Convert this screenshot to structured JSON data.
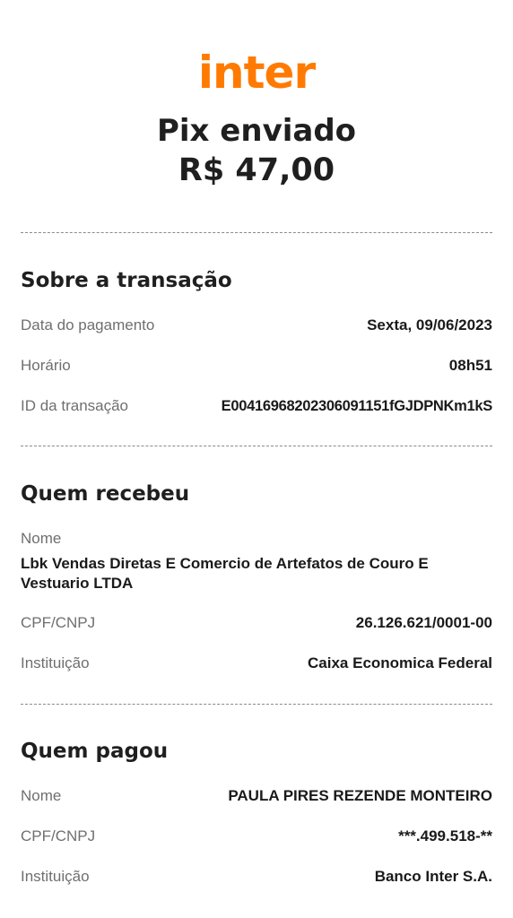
{
  "brand": {
    "logo_text": "inter",
    "accent_color": "#ff7a00"
  },
  "header": {
    "title": "Pix enviado",
    "amount": "R$ 47,00"
  },
  "transaction": {
    "section_title": "Sobre a transação",
    "payment_date_label": "Data do pagamento",
    "payment_date_value": "Sexta, 09/06/2023",
    "time_label": "Horário",
    "time_value": "08h51",
    "id_label": "ID da transação",
    "id_value": "E00416968202306091151fGJDPNKm1kS"
  },
  "receiver": {
    "section_title": "Quem recebeu",
    "name_label": "Nome",
    "name_value": "Lbk Vendas Diretas E Comercio de Artefatos de Couro E Vestuario LTDA",
    "doc_label": "CPF/CNPJ",
    "doc_value": "26.126.621/0001-00",
    "institution_label": "Instituição",
    "institution_value": "Caixa Economica Federal"
  },
  "payer": {
    "section_title": "Quem pagou",
    "name_label": "Nome",
    "name_value": "PAULA PIRES REZENDE MONTEIRO",
    "doc_label": "CPF/CNPJ",
    "doc_value": "***.499.518-**",
    "institution_label": "Instituição",
    "institution_value": "Banco Inter S.A."
  }
}
